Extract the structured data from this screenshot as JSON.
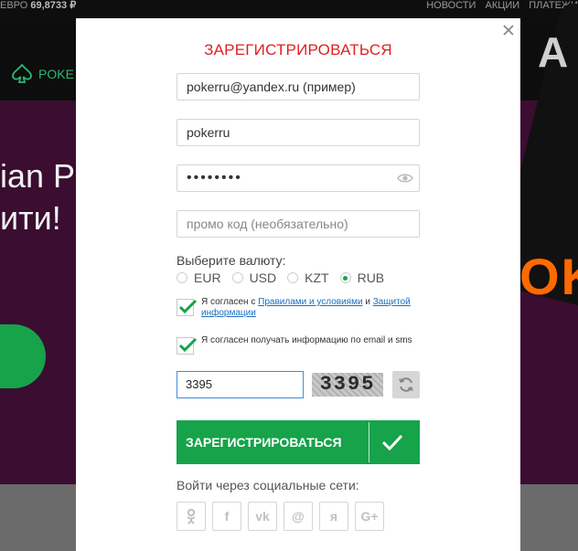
{
  "background": {
    "euro_label": "ЕВРО",
    "euro_value": "69,8733 ₽",
    "nav": [
      "НОВОСТИ",
      "АКЦИИ",
      "ПЛАТЕЖИ"
    ],
    "logo_text": "POKE",
    "hero_line1": "ian Po",
    "hero_line2": "ити!",
    "card_letter": "A",
    "orange_text": "OK"
  },
  "modal": {
    "title": "ЗАРЕГИСТРИРОВАТЬСЯ",
    "email_value": "pokerru@yandex.ru (пример)",
    "login_value": "pokerru",
    "password_value": "••••••••",
    "promo_placeholder": "промо код (необязательно)",
    "currency_label": "Выберите валюту:",
    "currencies": [
      {
        "label": "EUR",
        "selected": false
      },
      {
        "label": "USD",
        "selected": false
      },
      {
        "label": "KZT",
        "selected": false
      },
      {
        "label": "RUB",
        "selected": true
      }
    ],
    "agree_prefix": "Я согласен с",
    "agree_link1": "Правилами и условиями",
    "agree_and": "и",
    "agree_link2": "Защитой информации",
    "agree_email_text": "Я согласен получать информацию по email и sms",
    "captcha_input": "3395",
    "captcha_image_text": "3395",
    "submit_label": "ЗАРЕГИСТРИРОВАТЬСЯ",
    "social_label": "Войти через социальные сети:",
    "socials": [
      {
        "icon": "odnoklassniki-icon",
        "glyph": "ok"
      },
      {
        "icon": "facebook-icon",
        "glyph": "f"
      },
      {
        "icon": "vk-icon",
        "glyph": "vk"
      },
      {
        "icon": "mail-icon",
        "glyph": "@"
      },
      {
        "icon": "yandex-icon",
        "glyph": "я"
      },
      {
        "icon": "google-plus-icon",
        "glyph": "G+"
      }
    ]
  },
  "colors": {
    "accent_green": "#16a34a",
    "title_red": "#e02020",
    "link_blue": "#1a6fc1",
    "hero_bg": "#3a0d31"
  }
}
